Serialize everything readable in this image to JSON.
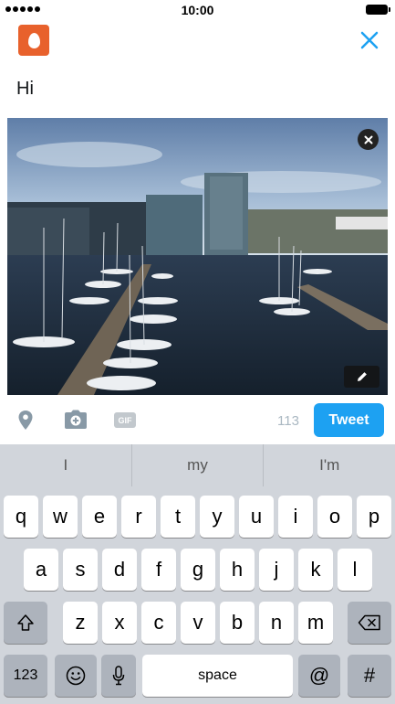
{
  "status_bar": {
    "time": "10:00"
  },
  "composer": {
    "tweet_text": "Hi",
    "char_remaining": "113",
    "tweet_button": "Tweet",
    "gif_label": "GIF"
  },
  "keyboard": {
    "suggestions": [
      "I",
      "my",
      "I'm"
    ],
    "row1": [
      "q",
      "w",
      "e",
      "r",
      "t",
      "y",
      "u",
      "i",
      "o",
      "p"
    ],
    "row2": [
      "a",
      "s",
      "d",
      "f",
      "g",
      "h",
      "j",
      "k",
      "l"
    ],
    "row3": [
      "z",
      "x",
      "c",
      "v",
      "b",
      "n",
      "m"
    ],
    "numbers_key": "123",
    "space_key": "space",
    "at_key": "@",
    "hash_key": "#"
  },
  "colors": {
    "brand_blue": "#1da1f2",
    "avatar_orange": "#e8612c"
  }
}
